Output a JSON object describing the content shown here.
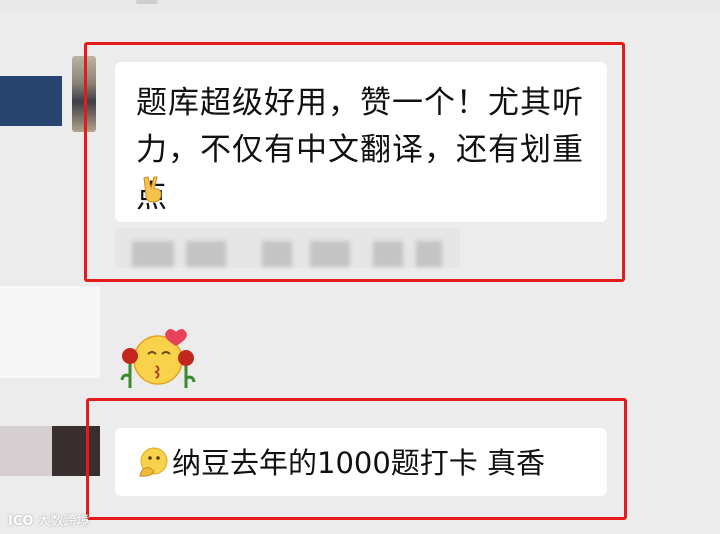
{
  "chat": {
    "message_1": "题库超级好用，赞一个！尤其听力，不仅有中文翻译，还有划重点",
    "message_2": "纳豆去年的1000题打卡 真香"
  },
  "icons": {
    "victory": "victory-hand-icon",
    "kiss_sticker": "kiss-face-with-roses-icon",
    "thinking": "thinking-face-icon"
  },
  "colors": {
    "highlight": "#e51b1b",
    "bubble": "#ffffff",
    "background": "#ececec"
  },
  "watermark": {
    "logo": "ICO",
    "text": "大数跨境"
  }
}
